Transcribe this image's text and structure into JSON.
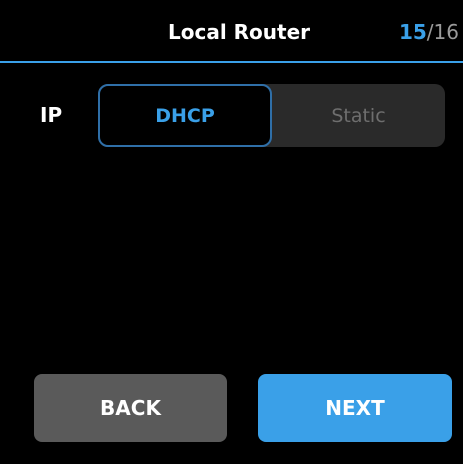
{
  "header": {
    "title": "Local Router",
    "progress": {
      "current": "15",
      "separator": "/",
      "total": "16"
    }
  },
  "ip_setting": {
    "label": "IP",
    "options": [
      {
        "label": "DHCP",
        "selected": true
      },
      {
        "label": "Static",
        "selected": false
      }
    ]
  },
  "footer": {
    "back_label": "BACK",
    "next_label": "NEXT"
  },
  "colors": {
    "accent": "#3aa0e8",
    "background": "#000000",
    "secondary_button": "#5a5a5a",
    "inactive_segment": "#2a2a2a"
  }
}
